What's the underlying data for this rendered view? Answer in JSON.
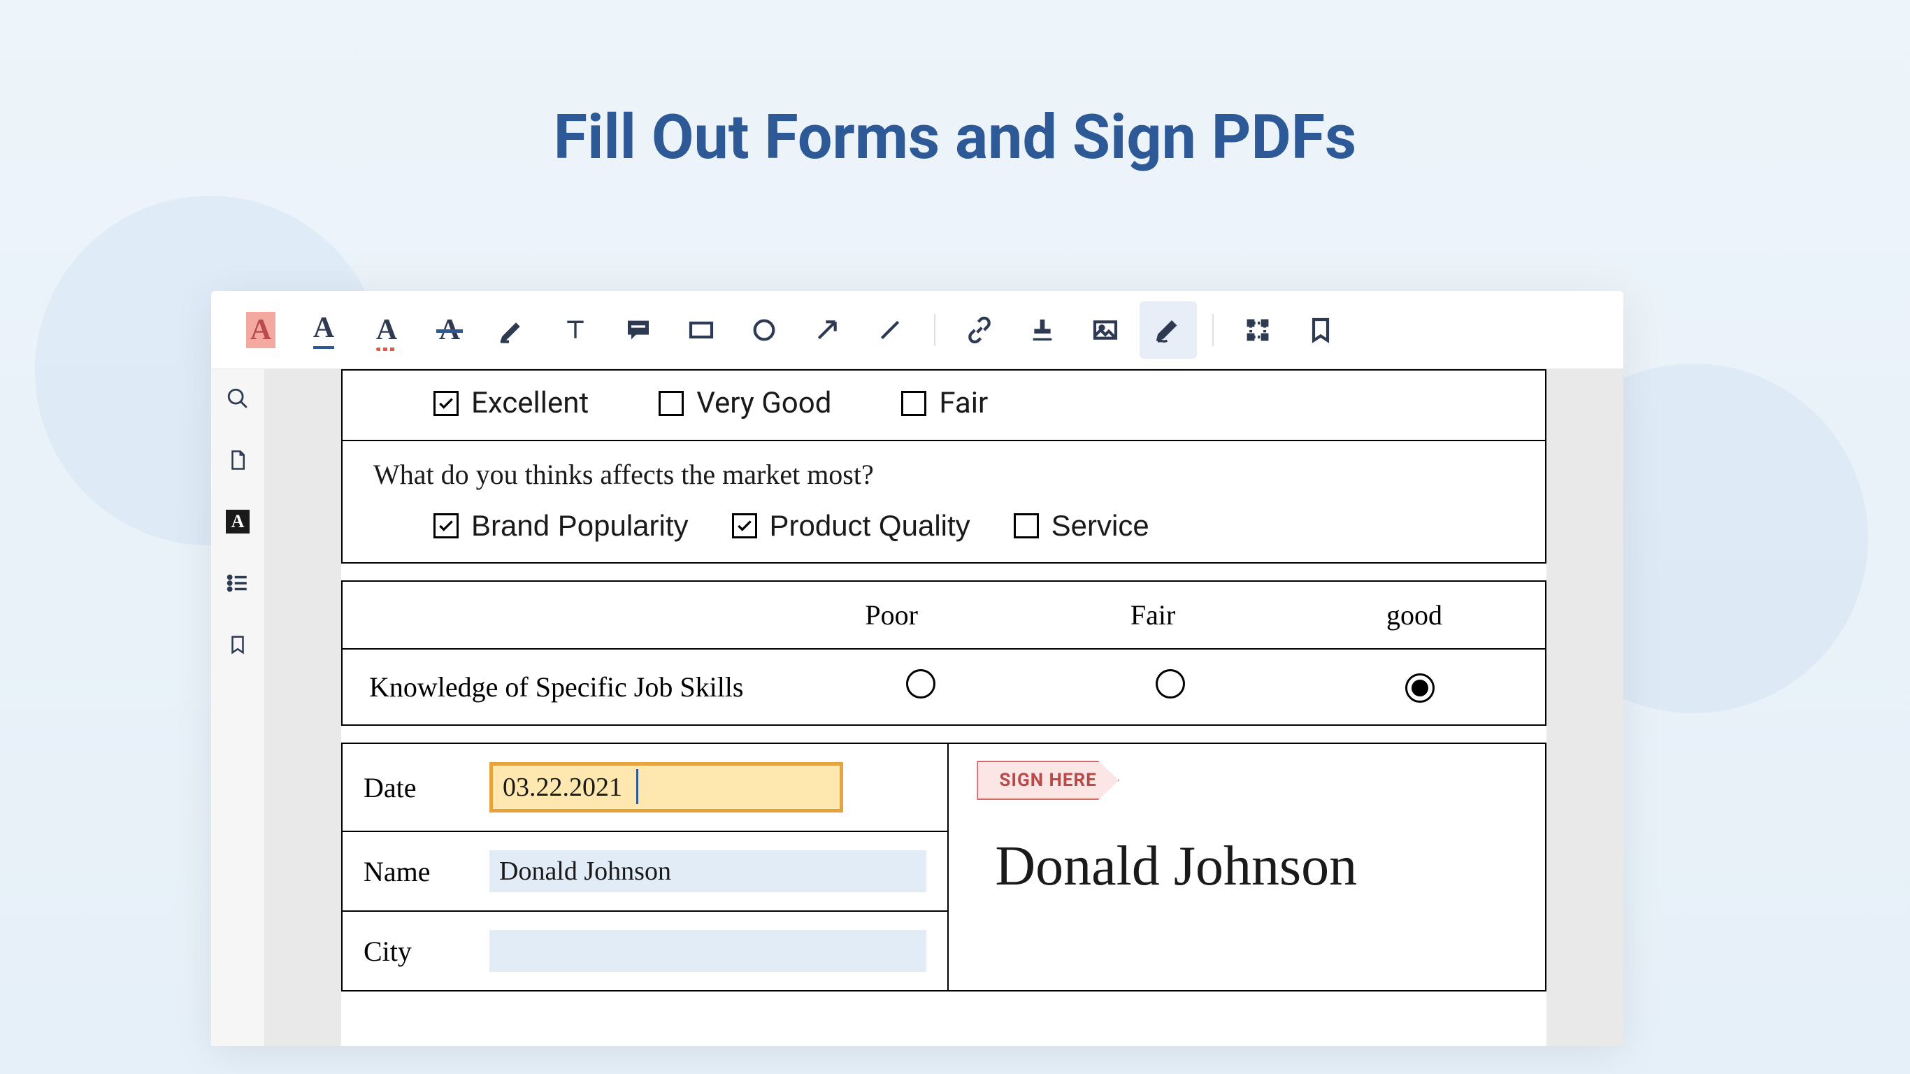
{
  "headline": "Fill Out Forms and Sign PDFs",
  "toolbar": {
    "highlight": "A",
    "underline": "A",
    "squiggly": "A",
    "strike": "A"
  },
  "form": {
    "rating_opts": {
      "excellent": "Excellent",
      "very_good": "Very Good",
      "fair": "Fair"
    },
    "rating_checked": {
      "excellent": true,
      "very_good": false,
      "fair": false
    },
    "question2": "What do you thinks affects the market most?",
    "q2_opts": {
      "brand": "Brand Popularity",
      "quality": "Product Quality",
      "service": "Service"
    },
    "q2_checked": {
      "brand": true,
      "quality": true,
      "service": false
    },
    "rating_table": {
      "col1": "Poor",
      "col2": "Fair",
      "col3": "good",
      "row1_label": "Knowledge of Specific Job Skills",
      "row1_selected": "col3"
    },
    "fields": {
      "date_label": "Date",
      "date_value": "03.22.2021",
      "name_label": "Name",
      "name_value": "Donald Johnson",
      "city_label": "City",
      "city_value": ""
    },
    "sign_here_label": "SIGN HERE",
    "signature_text": "Donald Johnson"
  }
}
